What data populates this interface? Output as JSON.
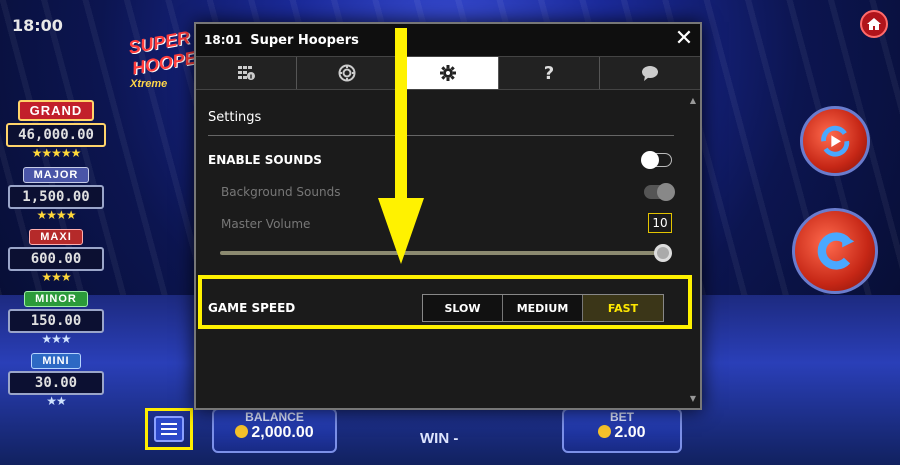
{
  "status": {
    "time": "18:01",
    "corner_time": "18:00"
  },
  "game": {
    "logo_line1": "SUPER HOOPERS",
    "logo_line2": "Xtreme"
  },
  "jackpots": [
    {
      "label": "GRAND",
      "value": "46,000.00",
      "stars": "★★★★★"
    },
    {
      "label": "MAJOR",
      "value": "1,500.00",
      "stars": "★★★★"
    },
    {
      "label": "MAXI",
      "value": "600.00",
      "stars": "★★★"
    },
    {
      "label": "MINOR",
      "value": "150.00",
      "stars": "★★★"
    },
    {
      "label": "MINI",
      "value": "30.00",
      "stars": "★★"
    }
  ],
  "bottom_bar": {
    "balance_label": "BALANCE",
    "balance_value": "2,000.00",
    "win_label": "WIN -",
    "bet_label": "BET",
    "bet_value": "2.00"
  },
  "modal": {
    "time": "18:01",
    "title": "Super Hoopers",
    "close_glyph": "✕",
    "tabs": [
      {
        "icon": "paytable-icon",
        "active": false
      },
      {
        "icon": "chip-icon",
        "active": false
      },
      {
        "icon": "gear-icon",
        "active": true
      },
      {
        "icon": "help-icon",
        "label": "?",
        "active": false
      },
      {
        "icon": "chat-icon",
        "active": false
      }
    ],
    "section_title": "Settings",
    "enable_sounds": {
      "label": "ENABLE SOUNDS",
      "on": false
    },
    "background_sounds": {
      "label": "Background Sounds",
      "on": true
    },
    "master_volume": {
      "label": "Master Volume",
      "value": "10",
      "level": 1.0
    },
    "game_speed": {
      "label": "GAME SPEED",
      "options": [
        "SLOW",
        "MEDIUM",
        "FAST"
      ],
      "selected": "FAST"
    }
  },
  "colors": {
    "highlight": "#fff200",
    "selected_text": "#ffe800",
    "modal_bg": "#1b1b1b"
  }
}
